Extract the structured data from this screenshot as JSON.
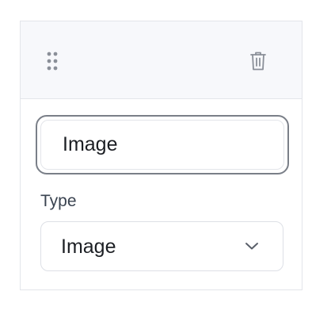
{
  "card": {
    "header": {
      "drag_icon": "drag-handle-icon",
      "delete_icon": "trash-icon"
    },
    "name_field": {
      "value": "Image"
    },
    "type_field": {
      "label": "Type",
      "selected": "Image",
      "chevron_icon": "chevron-down-icon"
    }
  },
  "colors": {
    "header_bg": "#f7f8fb",
    "border": "#e3e5ea",
    "focus_border": "#7a7f88",
    "icon": "#8a8f98",
    "text": "#1c1f24",
    "label": "#3a4350"
  }
}
